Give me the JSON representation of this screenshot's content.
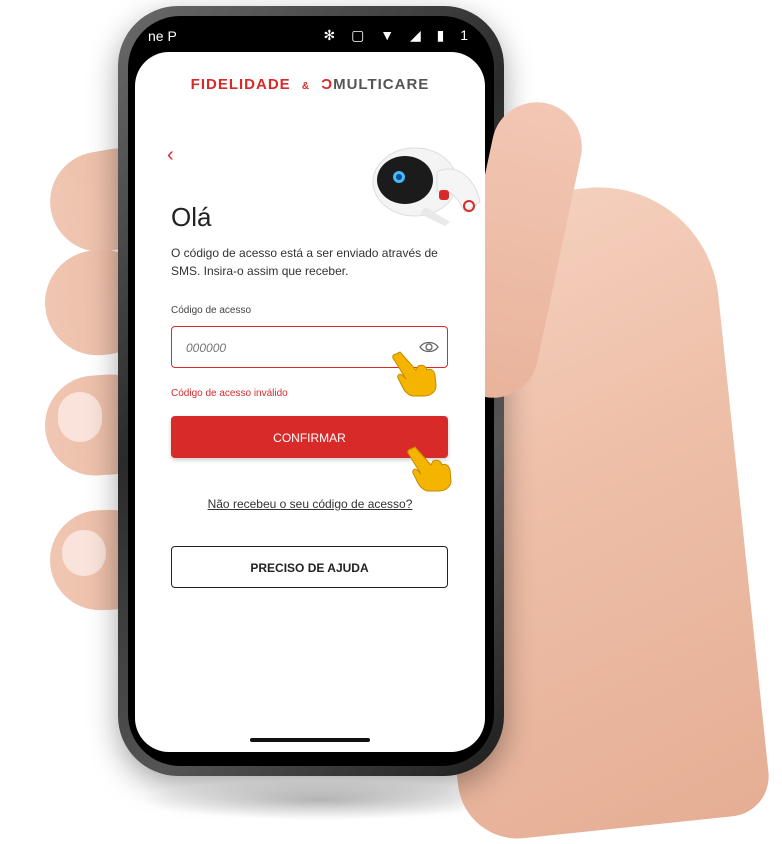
{
  "status_bar": {
    "carrier": "ne P",
    "icons": "✻ ▢ ▼ ◢ ▮ 1"
  },
  "app": {
    "brand_left": "FIDELIDADE",
    "brand_sep": "&",
    "brand_right": "MULTICARE",
    "back_icon": "‹",
    "title": "Olá",
    "description": "O código de acesso está a ser enviado  através de SMS. Insira-o assim que receber.",
    "code_field": {
      "label": "Código de acesso",
      "placeholder": "000000",
      "value": ""
    },
    "error": "Código de acesso inválido",
    "confirm_label": "CONFIRMAR",
    "resend_link": "Não recebeu o seu código de acesso?",
    "help_label": "PRECISO DE AJUDA"
  },
  "colors": {
    "accent": "#d92a2a",
    "text": "#222222",
    "background": "#ffffff"
  },
  "icons": [
    "back-chevron-icon",
    "eye-icon",
    "hand-pointer-icon"
  ]
}
